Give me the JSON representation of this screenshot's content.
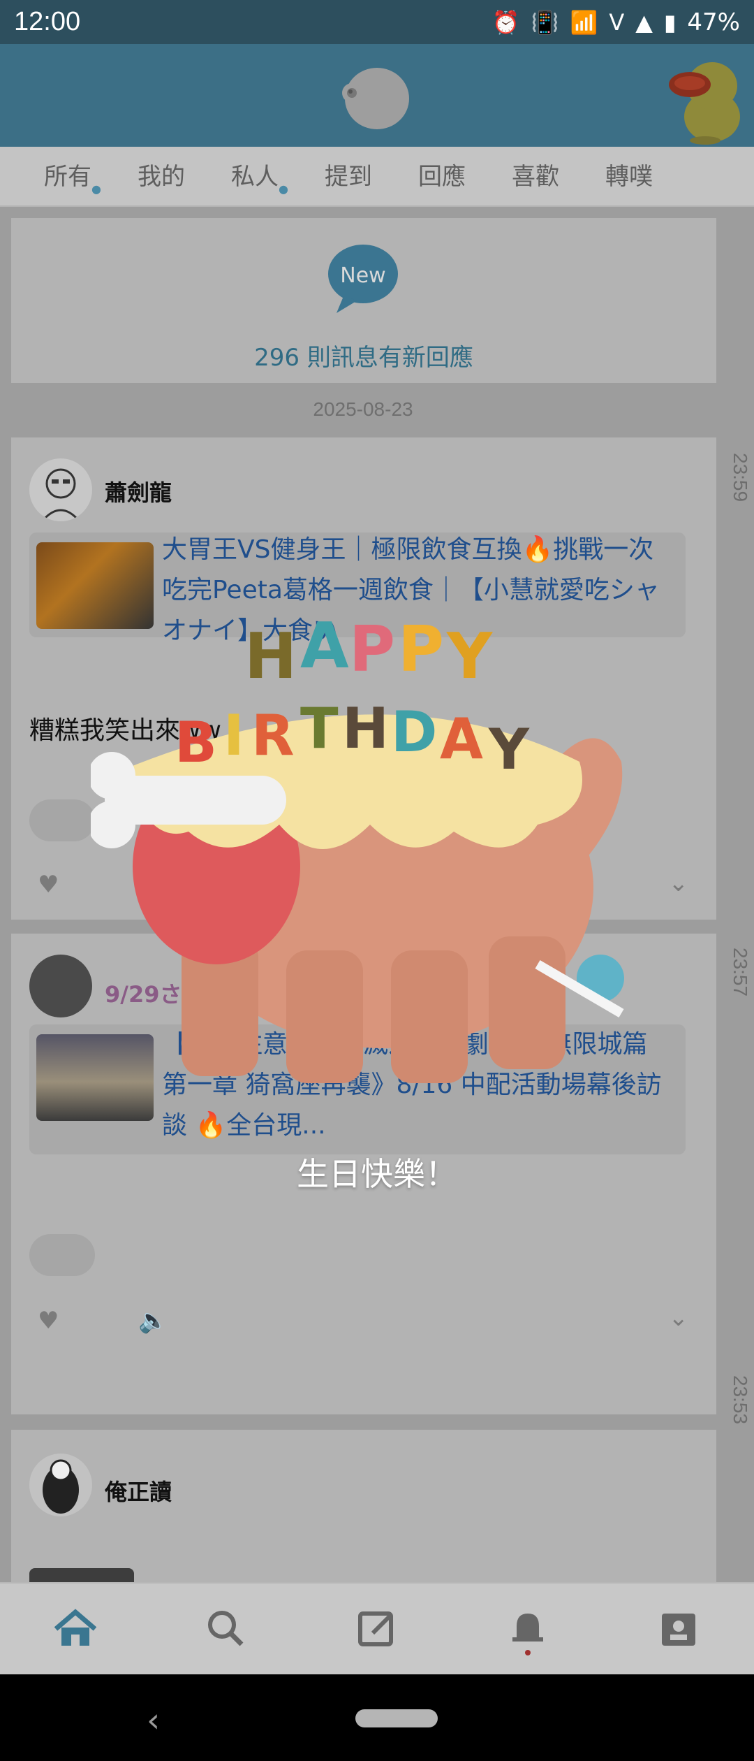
{
  "status": {
    "time": "12:00",
    "signal": "V",
    "battery": "47%"
  },
  "tabs": [
    {
      "label": "所有",
      "active": true,
      "dot": true
    },
    {
      "label": "我的",
      "active": false,
      "dot": false
    },
    {
      "label": "私人",
      "active": false,
      "dot": true
    },
    {
      "label": "提到",
      "active": false,
      "dot": false
    },
    {
      "label": "回應",
      "active": false,
      "dot": false
    },
    {
      "label": "喜歡",
      "active": false,
      "dot": false
    },
    {
      "label": "轉噗",
      "active": false,
      "dot": false
    }
  ],
  "new_card": {
    "badge": "New",
    "text": "296 則訊息有新回應"
  },
  "date_sep": "2025-08-23",
  "posts": [
    {
      "time": "23:59",
      "author": "蕭劍龍",
      "link_text": "大胃王VS健身王｜極限飲食互換🔥挑戰一次吃完Peeta葛格一週飲食｜【小慧就愛吃シャオナイ】大食い",
      "body": "糟糕我笑出來ww"
    },
    {
      "time": "23:57",
      "author": "9/29さちか",
      "link_text": "【有雷注意！《鬼滅之刃》劇場版 無限城篇 第一章 猗窩座再襲》8/16 中配活動場幕後訪談 🔥全台現..."
    },
    {
      "time": "23:53",
      "author": "俺正讀"
    }
  ],
  "overlay": {
    "text": "生日快樂！"
  },
  "icons": {
    "home": "home-icon",
    "search": "search-icon",
    "compose": "compose-icon",
    "notifications": "bell-icon",
    "profile": "profile-icon"
  },
  "colors": {
    "accent": "#3a7690",
    "header": "#3c6f86"
  }
}
